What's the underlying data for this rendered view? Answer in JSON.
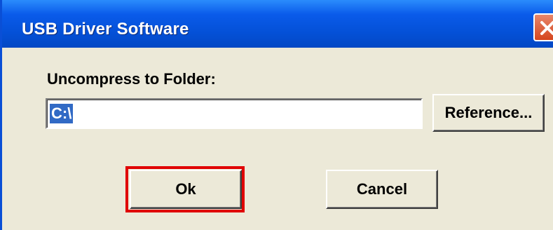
{
  "window": {
    "title": "USB Driver Software"
  },
  "dialog": {
    "folder_label": "Uncompress to Folder:",
    "folder_value": "C:\\",
    "reference_button": "Reference...",
    "ok_button": "Ok",
    "cancel_button": "Cancel"
  },
  "colors": {
    "titlebar": "#0450d6",
    "dialog_bg": "#ece9d8",
    "selection": "#316ac5",
    "ok_highlight": "#e00000",
    "close_button": "#d5461e"
  },
  "icons": {
    "close": "close-icon"
  }
}
